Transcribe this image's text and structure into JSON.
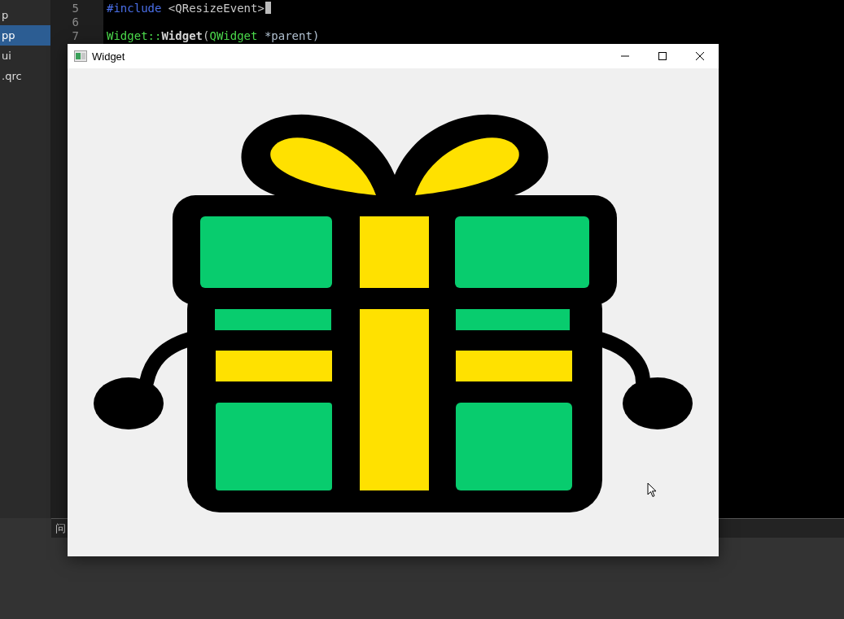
{
  "ide": {
    "sidebar": {
      "items": [
        {
          "label": "p",
          "selected": false
        },
        {
          "label": "pp",
          "selected": true
        },
        {
          "label": "ui",
          "selected": false
        },
        {
          "label": ".qrc",
          "selected": false
        }
      ]
    },
    "editor": {
      "lines": [
        {
          "number": "5",
          "tokens": [
            {
              "kind": "directive",
              "text": "#include"
            },
            {
              "kind": "plain",
              "text": " <QResizeEvent>"
            }
          ]
        },
        {
          "number": "6"
        },
        {
          "number": "7",
          "tokens": [
            {
              "kind": "type",
              "text": "Widget::"
            },
            {
              "kind": "function",
              "text": "Widget"
            },
            {
              "kind": "plain",
              "text": "("
            },
            {
              "kind": "type",
              "text": "QWidget"
            },
            {
              "kind": "param",
              "text": " *parent)"
            }
          ]
        }
      ]
    },
    "bottom_panel": {
      "tab": "问"
    }
  },
  "window": {
    "title": "Widget"
  }
}
